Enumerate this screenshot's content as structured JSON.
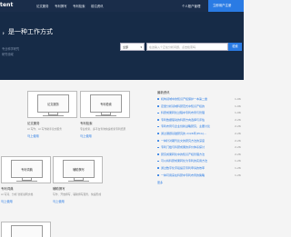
{
  "nav": {
    "brand": "tent",
    "links": [
      "论文服务",
      "专利撰写",
      "专利检索",
      "前沿资讯"
    ],
    "account": "个人账户管理",
    "cta": "立即用户注册"
  },
  "hero": {
    "title": "，是一种工作方式",
    "sub_lines": [
      "专业科学研究",
      "研究领域"
    ]
  },
  "search": {
    "select_value": "全部",
    "placeholder": "在这输入个正在分析问题，点击检索吗",
    "button": "检索"
  },
  "tools": [
    {
      "screen": "论文服务",
      "name": "论文服务",
      "desc": "AI 写作、AI 写作助手论文服务",
      "use": "马上使用"
    },
    {
      "screen": "专利检索",
      "name": "专利检索",
      "desc": "专业检索、多平台查询快速检索专利结果",
      "use": "马上使用"
    },
    {
      "screen": "专利词典",
      "name": "专利词典",
      "desc": "AI 写词、分析 智能说明文档",
      "use": "马上使用"
    },
    {
      "screen": "辅助撰写",
      "name": "辅助撰写",
      "desc": "写作、开放撰写、辅助撰写服务，快速形成",
      "use": "马上使用"
    },
    {
      "screen": "",
      "name": "",
      "desc": "",
      "use": ""
    }
  ],
  "news": {
    "heading": "最新资讯",
    "items": [
      {
        "title": "机构领域中的知识产权保护一本第二章",
        "date": "1-06"
      },
      {
        "title": "定量分析领域科研范式中知识产权的",
        "date": "1-06"
      },
      {
        "title": "科研成果转化过程中专利布局与管理",
        "date": "1-06"
      },
      {
        "title": "专利数据驱动的科研方向选择与评估",
        "date": "2-26"
      },
      {
        "title": "专利布局与企业创新战略研究，主要讨论",
        "date": "2-26"
      },
      {
        "title": "通过课题基础研究的 2/4/6年(PCA)…",
        "date": "2-26"
      },
      {
        "title": "一种针对期刊论文的研究方法的深度",
        "date": "2-26"
      },
      {
        "title": "专利门槛与科研成果的评价体系探讨",
        "date": "2-26"
      },
      {
        "title": "研究成果转化中的知识产权管理方法",
        "date": "2-26"
      },
      {
        "title": "可以将科研成果转化为专利的实用方法",
        "date": "1-26"
      },
      {
        "title": "通过数字化手段提高专利申请的效率",
        "date": "1-26"
      },
      {
        "title": "一种可用来在科研中专利布局的策略",
        "date": "1-26"
      }
    ],
    "more": "更多"
  }
}
